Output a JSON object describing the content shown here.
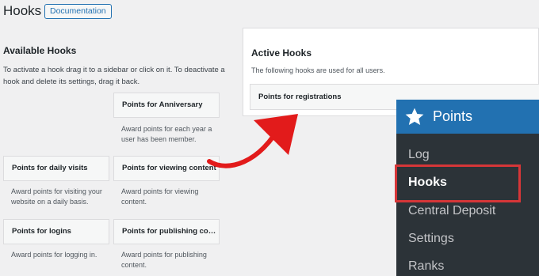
{
  "header": {
    "title": "Hooks",
    "doc_button": "Documentation"
  },
  "available": {
    "title": "Available Hooks",
    "description": "To activate a hook drag it to a sidebar or click on it. To deactivate a hook and delete its settings, drag it back.",
    "hooks": [
      {
        "label": "Points for Anniversary",
        "desc": "Award points for each year a user has been member."
      },
      {
        "label": "Points for daily visits",
        "desc": "Award points for visiting your website on a daily basis."
      },
      {
        "label": "Points for viewing content",
        "desc": "Award points for viewing content."
      },
      {
        "label": "Points for logins",
        "desc": "Award points for logging in."
      },
      {
        "label": "Points for publishing con...",
        "desc": "Award points for publishing content."
      }
    ]
  },
  "active": {
    "title": "Active Hooks",
    "description": "The following hooks are used for all users.",
    "hook": "Points for registrations"
  },
  "menu": {
    "title": "Points",
    "items": [
      "Log",
      "Hooks",
      "Central Deposit",
      "Settings",
      "Ranks"
    ],
    "current": "Hooks"
  },
  "colors": {
    "accent": "#2271b1",
    "highlight": "#d63638",
    "arrow": "#e21b1b"
  }
}
